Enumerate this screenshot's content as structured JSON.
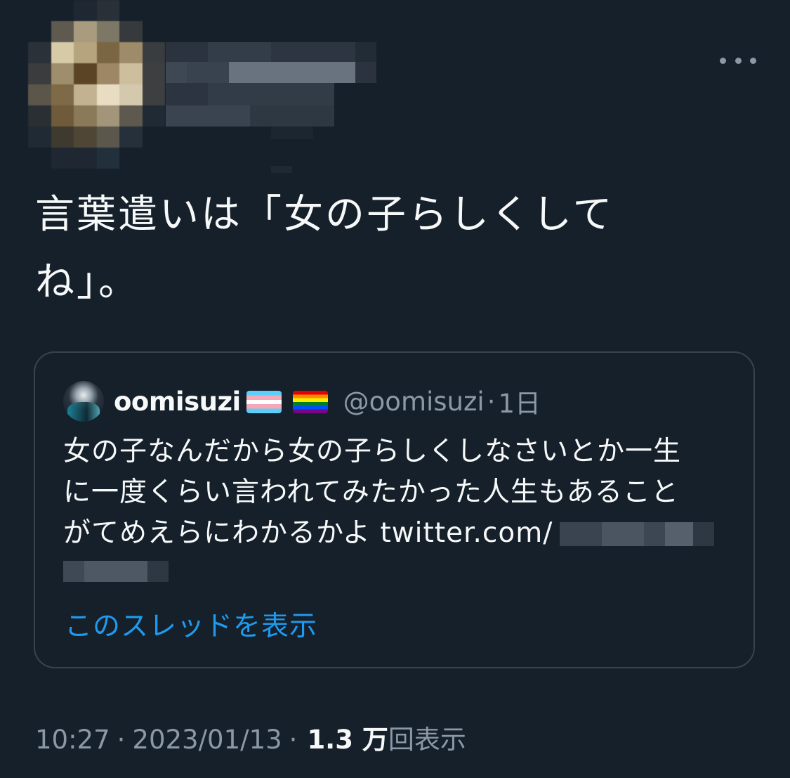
{
  "author": {
    "avatar_pixels": [
      [
        "#15202b",
        "#15202b",
        "#1e2732",
        "#2a3038",
        "#15202b",
        "#15202b"
      ],
      [
        "#15202b",
        "#5f5a4f",
        "#a99b7e",
        "#7d7766",
        "#363a3c",
        "#15202b"
      ],
      [
        "#2b3138",
        "#d7cba7",
        "#b6a47f",
        "#7a6642",
        "#9d8b6a",
        "#3a3d3f"
      ],
      [
        "#3a3c3d",
        "#9f8e6b",
        "#5a4425",
        "#9d8764",
        "#cdbf9d",
        "#3d3f40"
      ],
      [
        "#5b5649",
        "#7f6a47",
        "#c2b28f",
        "#e8ddc3",
        "#d4c9ad",
        "#3d3f40"
      ],
      [
        "#2a2f34",
        "#6f5a3a",
        "#8b7a5a",
        "#a39579",
        "#5e594e",
        "#1f2a35"
      ],
      [
        "#1f2a35",
        "#3f3a30",
        "#4f4635",
        "#5b574d",
        "#26303a",
        "#15202b"
      ],
      [
        "#15202b",
        "#1e2732",
        "#1e2732",
        "#22303c",
        "#15202b",
        "#15202b"
      ]
    ]
  },
  "tweet": {
    "text": "言葉遣いは「女の子らしくしてね」。"
  },
  "quote": {
    "name": "oomisuzi",
    "handle": "@oomisuzi",
    "dot": "·",
    "time": "1日",
    "text_lines": [
      "女の子なんだから女の子らしくしなさいとか一生",
      "に一度くらい言われてみたかった人生もあること",
      "がてめえらにわかるかよ "
    ],
    "link_text": "twitter.com/",
    "show_thread": "このスレッドを表示"
  },
  "meta": {
    "time": "10:27",
    "sep": "·",
    "date": "2023/01/13",
    "views_count": "1.3 万",
    "views_label": "回表示"
  },
  "colors": {
    "background": "#15202b",
    "text": "#f7f9f9",
    "secondary": "#8b98a5",
    "accent": "#1d9bf0",
    "border": "#38444d"
  },
  "icons": {
    "more": "more-horizontal-icon",
    "flags": [
      "transgender-flag-icon",
      "rainbow-flag-icon"
    ]
  }
}
